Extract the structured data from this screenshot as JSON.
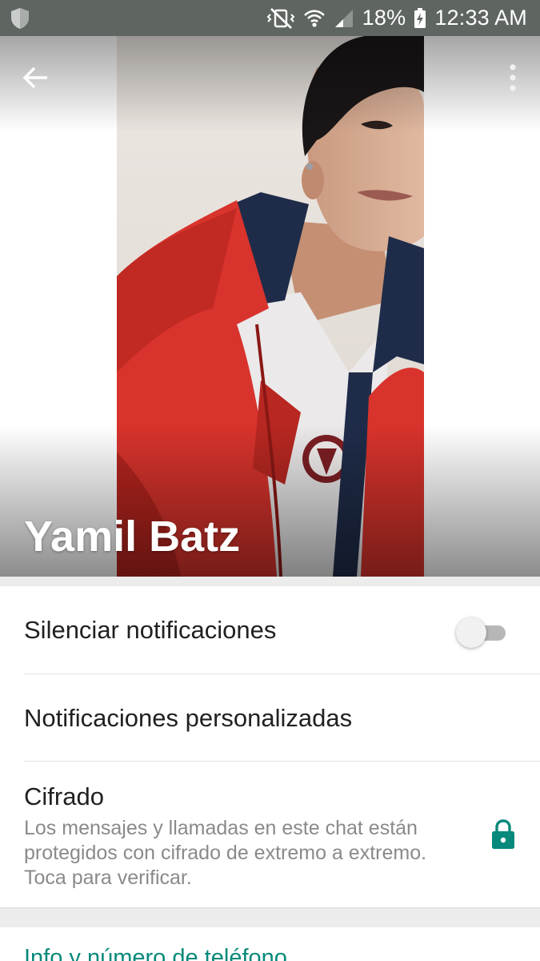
{
  "status_bar": {
    "icons": [
      "shield-icon",
      "vibrate-mute-icon",
      "wifi-icon",
      "signal-icon",
      "battery-charging-icon"
    ],
    "battery": "18%",
    "time": "12:33 AM"
  },
  "header": {
    "contact_name": "Yamil Batz",
    "back_icon": "back-arrow-icon",
    "menu_icon": "overflow-menu-icon"
  },
  "settings": {
    "mute": {
      "label": "Silenciar notificaciones",
      "enabled": false
    },
    "custom_notifications": {
      "label": "Notificaciones personalizadas"
    },
    "encryption": {
      "title": "Cifrado",
      "line1": "Los mensajes y llamadas en este chat están",
      "line2": "protegidos con cifrado de extremo a extremo.",
      "line3": "Toca para verificar.",
      "icon": "lock-icon"
    }
  },
  "info_section": {
    "title": "Info y número de teléfono"
  },
  "colors": {
    "status_bar": "#5f6661",
    "accent": "#07897b",
    "jacket": "#d8332c"
  }
}
